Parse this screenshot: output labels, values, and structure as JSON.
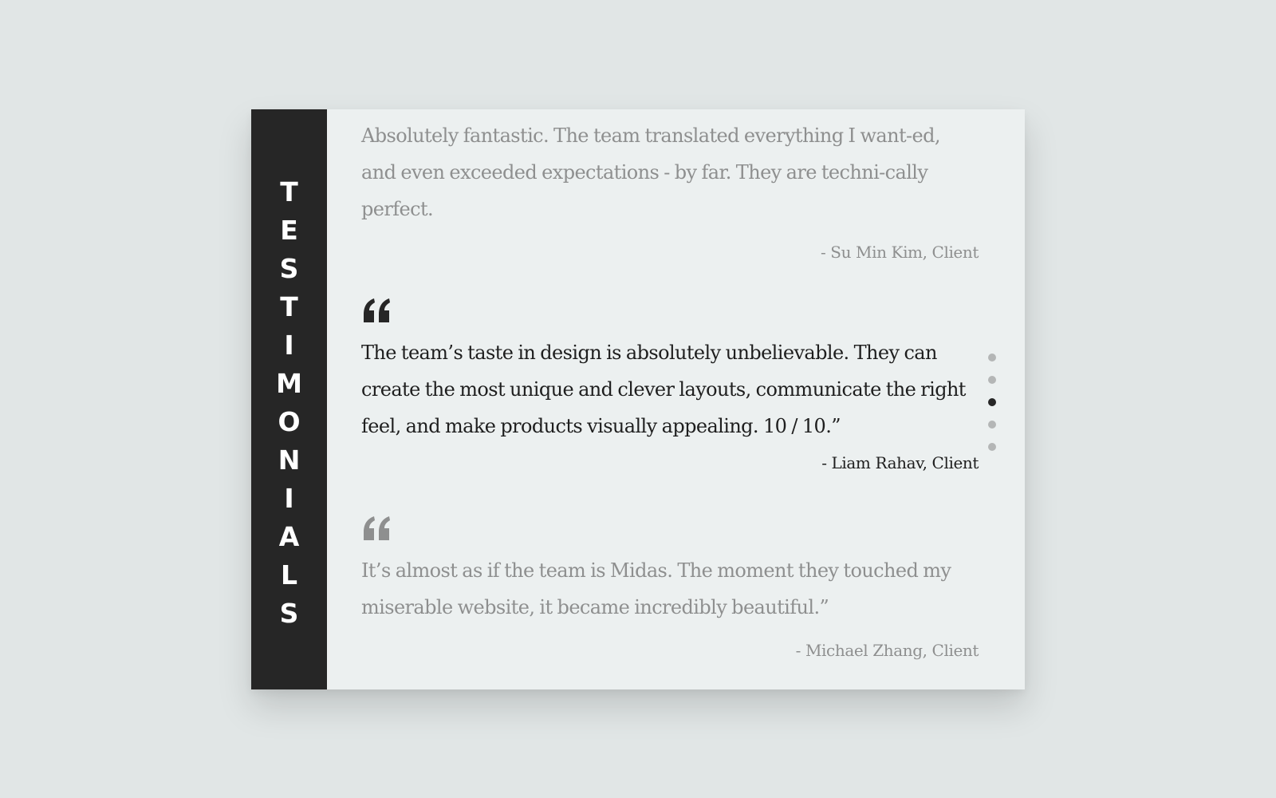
{
  "sidebar": {
    "title_letters": [
      "T",
      "E",
      "S",
      "T",
      "I",
      "M",
      "O",
      "N",
      "I",
      "A",
      "L",
      "S"
    ]
  },
  "testimonials": [
    {
      "text": "Absolutely fantastic. The team translated everything I want-ed, and even exceeded expectations - by far. They are techni-cally perfect.",
      "author": "- Su Min Kim, Client"
    },
    {
      "text": "The team’s taste in design is absolutely unbelievable. They can create the most unique and clever layouts, communicate the right feel, and make products visually appealing. 10 / 10.”",
      "author": "- Liam Rahav, Client"
    },
    {
      "text": "It’s almost as if the team is Midas. The moment they touched my miserable website, it became incredibly beautiful.”",
      "author": "- Michael Zhang, Client"
    }
  ],
  "pagination": {
    "count": 5,
    "current": 3
  },
  "icons": {
    "quote": "quote-open-icon"
  },
  "colors": {
    "background": "#e1e6e6",
    "card": "#ecf0f0",
    "sidebar": "#262626",
    "text_active": "#1e1e1e",
    "text_dim": "#8e8f8f",
    "dot_inactive": "#b4b6b6",
    "dot_active": "#262626"
  }
}
